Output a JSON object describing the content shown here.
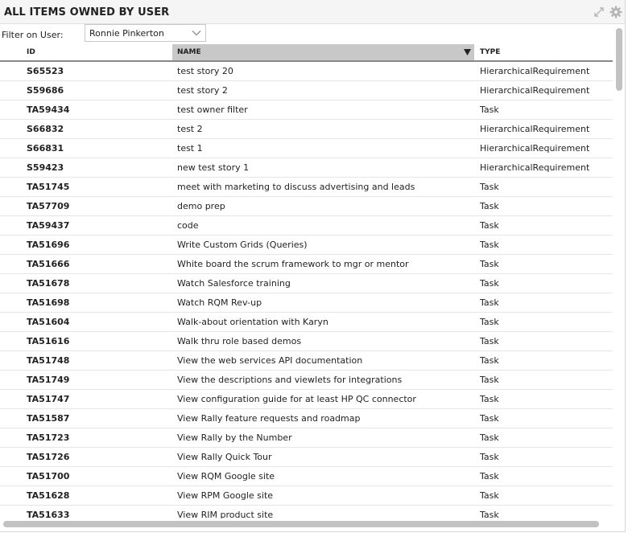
{
  "panel": {
    "title": "ALL ITEMS OWNED BY USER"
  },
  "filter": {
    "label": "Filter on User:",
    "selected": "Ronnie Pinkerton"
  },
  "columns": [
    "ID",
    "NAME",
    "TYPE"
  ],
  "rows": [
    {
      "id": "S65523",
      "name": "test story 20",
      "type": "HierarchicalRequirement"
    },
    {
      "id": "S59686",
      "name": "test story 2",
      "type": "HierarchicalRequirement"
    },
    {
      "id": "TA59434",
      "name": "test owner filter",
      "type": "Task"
    },
    {
      "id": "S66832",
      "name": "test 2",
      "type": "HierarchicalRequirement"
    },
    {
      "id": "S66831",
      "name": "test 1",
      "type": "HierarchicalRequirement"
    },
    {
      "id": "S59423",
      "name": "new test story 1",
      "type": "HierarchicalRequirement"
    },
    {
      "id": "TA51745",
      "name": "meet with marketing to discuss advertising and leads",
      "type": "Task"
    },
    {
      "id": "TA57709",
      "name": "demo prep",
      "type": "Task"
    },
    {
      "id": "TA59437",
      "name": "code",
      "type": "Task"
    },
    {
      "id": "TA51696",
      "name": "Write Custom Grids (Queries)",
      "type": "Task"
    },
    {
      "id": "TA51666",
      "name": "White board the scrum framework to mgr or mentor",
      "type": "Task"
    },
    {
      "id": "TA51678",
      "name": "Watch Salesforce training",
      "type": "Task"
    },
    {
      "id": "TA51698",
      "name": "Watch RQM Rev-up",
      "type": "Task"
    },
    {
      "id": "TA51604",
      "name": "Walk-about orientation with Karyn",
      "type": "Task"
    },
    {
      "id": "TA51616",
      "name": "Walk thru role based demos",
      "type": "Task"
    },
    {
      "id": "TA51748",
      "name": "View the web services API documentation",
      "type": "Task"
    },
    {
      "id": "TA51749",
      "name": "View the descriptions and viewlets for integrations",
      "type": "Task"
    },
    {
      "id": "TA51747",
      "name": "View configuration guide for at least HP QC connector",
      "type": "Task"
    },
    {
      "id": "TA51587",
      "name": "View Rally feature requests and roadmap",
      "type": "Task"
    },
    {
      "id": "TA51723",
      "name": "View Rally by the Number",
      "type": "Task"
    },
    {
      "id": "TA51726",
      "name": "View Rally Quick Tour",
      "type": "Task"
    },
    {
      "id": "TA51700",
      "name": "View RQM Google site",
      "type": "Task"
    },
    {
      "id": "TA51628",
      "name": "View RPM Google site",
      "type": "Task"
    },
    {
      "id": "TA51633",
      "name": "View RIM product site",
      "type": "Task"
    }
  ],
  "icons": {
    "expand": "expand-icon",
    "settings": "gear-icon",
    "dropdown": "chevron-down-icon",
    "sort": "sort-desc-icon"
  },
  "colors": {
    "header_bg": "#f5f5f5",
    "sorted_column_bg": "#c8c8c8",
    "row_divider": "#e6e6e6",
    "scroll_thumb": "#c2c2c2"
  }
}
